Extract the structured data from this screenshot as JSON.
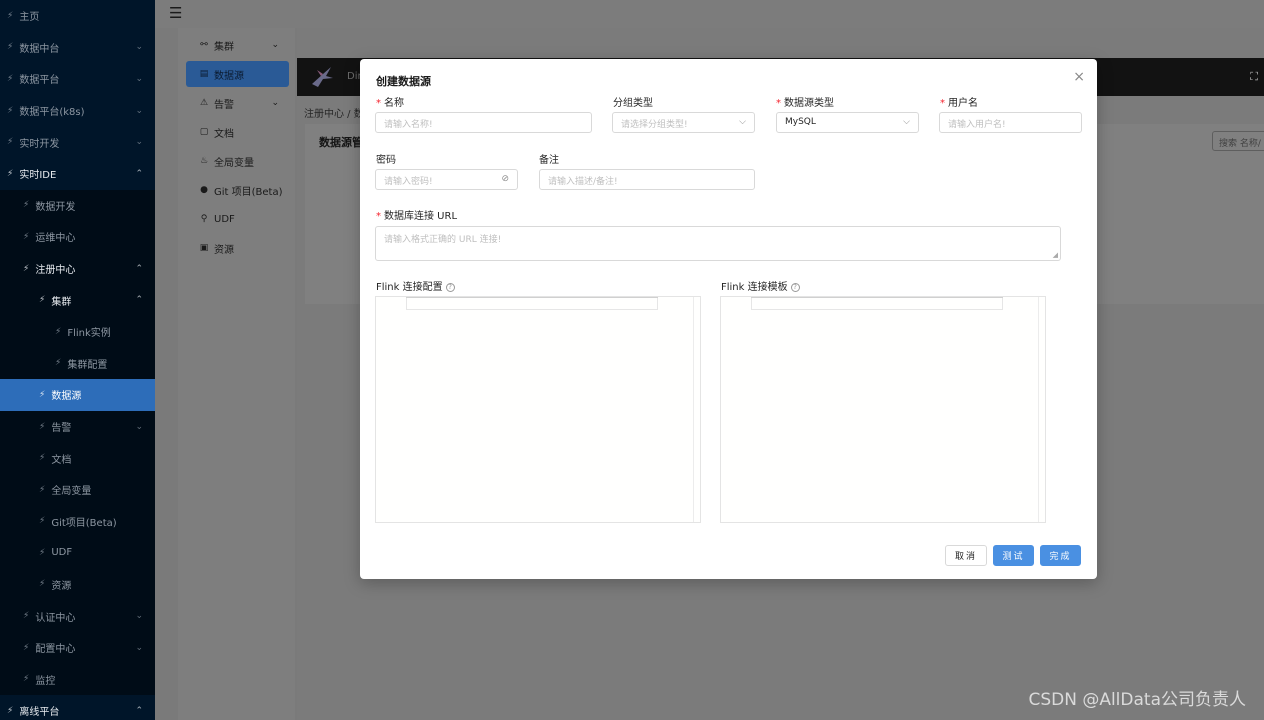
{
  "sidebar": {
    "items": [
      {
        "label": "主页",
        "caret": ""
      },
      {
        "label": "数据中台",
        "caret": "⌄"
      },
      {
        "label": "数据平台",
        "caret": "⌄"
      },
      {
        "label": "数据平台(k8s)",
        "caret": "⌄"
      },
      {
        "label": "实时开发",
        "caret": "⌄"
      },
      {
        "label": "实时IDE",
        "caret": "⌃"
      },
      {
        "label": "数据开发",
        "caret": ""
      },
      {
        "label": "运维中心",
        "caret": ""
      },
      {
        "label": "注册中心",
        "caret": "⌃"
      },
      {
        "label": "集群",
        "caret": "⌃"
      },
      {
        "label": "Flink实例",
        "caret": ""
      },
      {
        "label": "集群配置",
        "caret": ""
      },
      {
        "label": "数据源",
        "caret": ""
      },
      {
        "label": "告警",
        "caret": "⌄"
      },
      {
        "label": "文档",
        "caret": ""
      },
      {
        "label": "全局变量",
        "caret": ""
      },
      {
        "label": "Git项目(Beta)",
        "caret": ""
      },
      {
        "label": "UDF",
        "caret": ""
      },
      {
        "label": "资源",
        "caret": ""
      },
      {
        "label": "认证中心",
        "caret": "⌄"
      },
      {
        "label": "配置中心",
        "caret": "⌄"
      },
      {
        "label": "监控",
        "caret": ""
      },
      {
        "label": "离线平台",
        "caret": "⌃"
      }
    ]
  },
  "submenu": {
    "items": [
      {
        "label": "集群",
        "icon": "⚯",
        "arrow": "⌄"
      },
      {
        "label": "数据源",
        "icon": "▤",
        "arrow": ""
      },
      {
        "label": "告警",
        "icon": "⚠",
        "arrow": "⌄"
      },
      {
        "label": "文档",
        "icon": "▢",
        "arrow": ""
      },
      {
        "label": "全局变量",
        "icon": "♨",
        "arrow": ""
      },
      {
        "label": "Git 项目(Beta)",
        "icon": "●",
        "arrow": ""
      },
      {
        "label": "UDF",
        "icon": "⚲",
        "arrow": ""
      },
      {
        "label": "资源",
        "icon": "▣",
        "arrow": ""
      }
    ]
  },
  "background": {
    "banner_text": "Din",
    "breadcrumb": "注册中心 / 数",
    "page_title": "数据源管",
    "search_placeholder": "搜索 名称/"
  },
  "modal": {
    "title": "创建数据源",
    "close": "×",
    "name": {
      "label": "名称",
      "placeholder": "请输入名称!"
    },
    "group_type": {
      "label": "分组类型",
      "placeholder": "请选择分组类型!"
    },
    "datasource_type": {
      "label": "数据源类型",
      "value": "MySQL"
    },
    "username": {
      "label": "用户名",
      "placeholder": "请输入用户名!"
    },
    "password": {
      "label": "密码",
      "placeholder": "请输入密码!"
    },
    "note": {
      "label": "备注",
      "placeholder": "请输入描述/备注!"
    },
    "url": {
      "label": "数据库连接 URL",
      "placeholder": "请输入格式正确的 URL 连接!"
    },
    "flink_config": {
      "label": "Flink 连接配置"
    },
    "flink_template": {
      "label": "Flink 连接模板"
    },
    "buttons": {
      "cancel": "取消",
      "test": "测试",
      "finish": "完成"
    }
  },
  "watermark": "CSDN @AllData公司负责人",
  "colors": {
    "sidebar_bg": "#001529",
    "active_item": "#2d6db9",
    "primary_button": "#4a90e2",
    "required_mark": "#f5222d"
  }
}
